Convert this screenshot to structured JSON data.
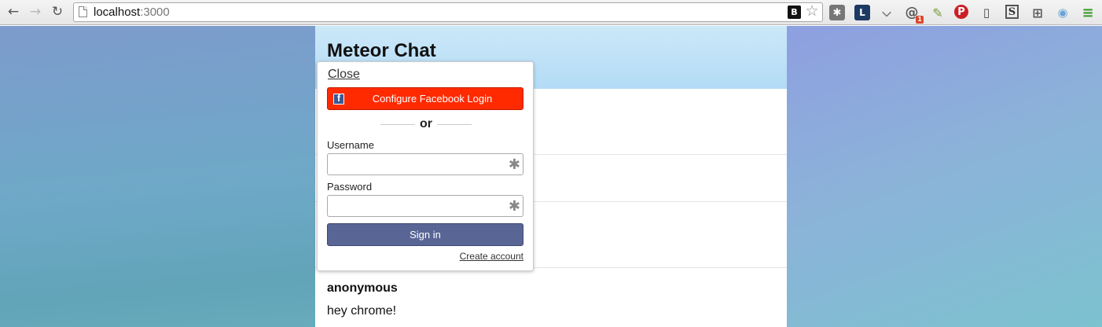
{
  "browser": {
    "url_host": "localhost",
    "url_port": ":3000",
    "icons": {
      "back": "back-arrow-icon",
      "forward": "forward-arrow-icon",
      "reload": "reload-icon",
      "page": "page-icon",
      "bookmark_b": "B",
      "star": "star-icon"
    },
    "extensions": {
      "asterisk": "✱",
      "lastpass": "L",
      "pocket": "pocket-icon",
      "at": "@",
      "at_badge": "1",
      "dropper": "eyedropper-icon",
      "pinterest": "P",
      "save": "save-icon",
      "s": "S",
      "grid": "grid-icon",
      "camera": "camera-icon",
      "menu": "menu-icon"
    }
  },
  "app": {
    "title": "Meteor Chat"
  },
  "messages": [
    {
      "author": "anonymous",
      "text": "hey chrome!"
    }
  ],
  "login": {
    "close_label": "Close",
    "facebook_button": "Configure Facebook Login",
    "facebook_icon_glyph": "f",
    "or_label": "or",
    "username_label": "Username",
    "password_label": "Password",
    "required_glyph": "✱",
    "signin_label": "Sign in",
    "create_account_label": "Create account"
  },
  "colors": {
    "facebook_button": "#ff2a00",
    "signin_button": "#596595",
    "header": "#b3dbf6"
  }
}
